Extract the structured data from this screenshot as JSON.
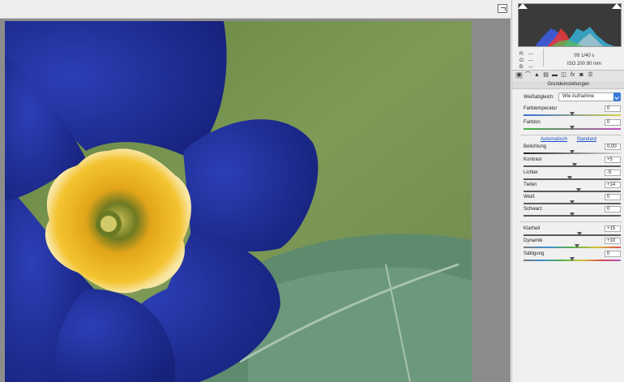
{
  "panel": {
    "rgb": [
      {
        "channel": "R:",
        "value": "---"
      },
      {
        "channel": "G:",
        "value": "---"
      },
      {
        "channel": "B:",
        "value": "---"
      }
    ],
    "camera": {
      "aperture_shutter": "f/8  1/40 s",
      "iso_focal": "ISO 200   90 mm"
    },
    "tabs": [
      {
        "icon": "aperture-icon"
      },
      {
        "icon": "tone-curve-icon"
      },
      {
        "icon": "detail-icon"
      },
      {
        "icon": "hsl-icon"
      },
      {
        "icon": "split-toning-icon"
      },
      {
        "icon": "lens-icon"
      },
      {
        "icon": "fx-icon"
      },
      {
        "icon": "camera-calibration-icon"
      },
      {
        "icon": "presets-icon"
      }
    ],
    "section_title": "Grundeinstellungen",
    "white_balance": {
      "label": "Weißabgleich:",
      "value": "Wie Aufnahme"
    },
    "temperature": {
      "label": "Farbtemperatur",
      "value": "0",
      "position": 0.5
    },
    "tint": {
      "label": "Farbton",
      "value": "0",
      "position": 0.5
    },
    "links": {
      "auto": "Automatisch",
      "default": "Standard"
    },
    "tone": [
      {
        "label": "Belichtung",
        "value": "0,00",
        "position": 0.5
      },
      {
        "label": "Kontrast",
        "value": "+5",
        "position": 0.525
      },
      {
        "label": "Lichter",
        "value": "-5",
        "position": 0.475
      },
      {
        "label": "Tiefen",
        "value": "+14",
        "position": 0.57
      },
      {
        "label": "Weiß",
        "value": "0",
        "position": 0.5
      },
      {
        "label": "Schwarz",
        "value": "0",
        "position": 0.5
      }
    ],
    "presence": [
      {
        "label": "Klarheit",
        "value": "+15",
        "position": 0.575
      },
      {
        "label": "Dynamik",
        "value": "+10",
        "position": 0.55
      },
      {
        "label": "Sättigung",
        "value": "0",
        "position": 0.5
      }
    ]
  },
  "colors": {
    "accent": "#3a7bd5",
    "link": "#1a4ec2",
    "flower_blue": "#1f2f9e",
    "flower_yellow": "#f1b51e"
  }
}
